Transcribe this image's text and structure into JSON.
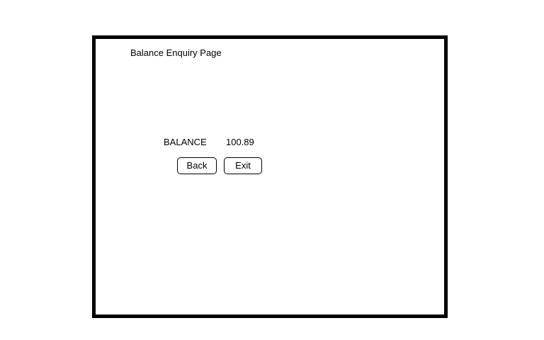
{
  "page": {
    "title": "Balance Enquiry Page"
  },
  "balance": {
    "label": "BALANCE",
    "value": "100.89"
  },
  "actions": {
    "back_label": "Back",
    "exit_label": "Exit"
  }
}
